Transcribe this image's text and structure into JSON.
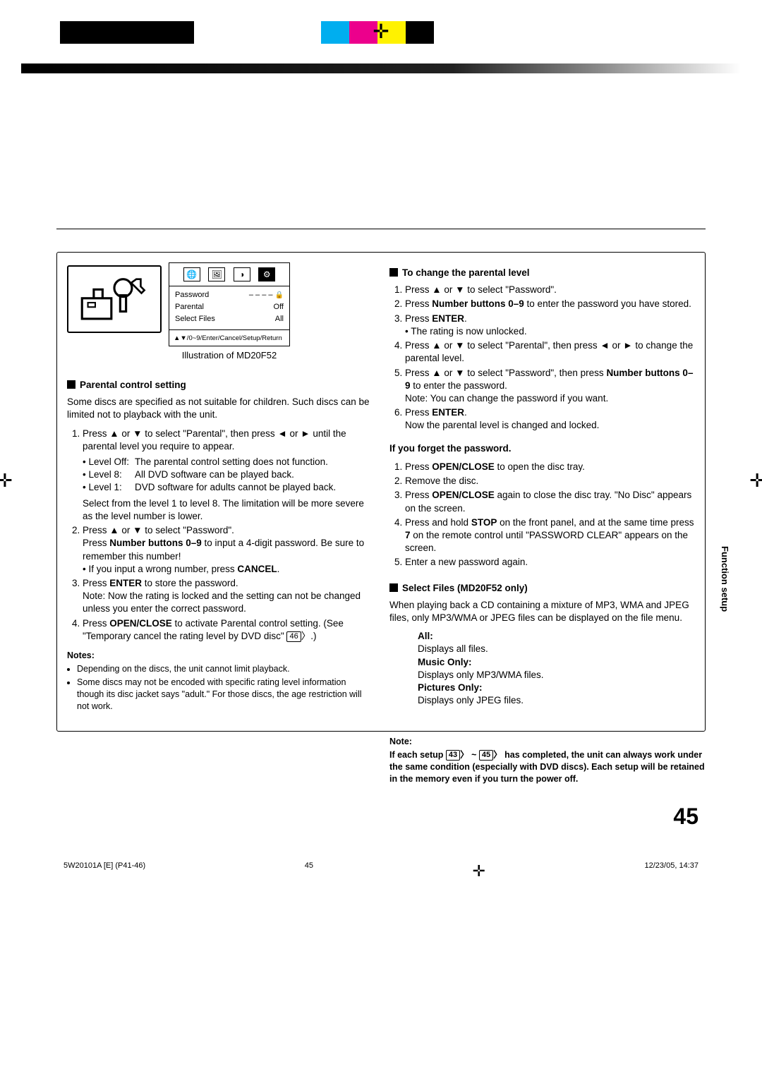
{
  "printMarks": {
    "crossGlyph": "✛"
  },
  "menu": {
    "row1": {
      "label": "Password",
      "value": "– – – –"
    },
    "row2": {
      "label": "Parental",
      "value": "Off"
    },
    "row3": {
      "label": "Select Files",
      "value": "All"
    },
    "hint": "▲▼/0~9/Enter/Cancel/Setup/Return",
    "caption": "Illustration of MD20F52"
  },
  "left": {
    "h1": "Parental control setting",
    "intro": "Some discs are specified as not suitable for children. Such discs can be limited not to playback with the unit.",
    "step1a": "Press ▲ or ▼ to select \"Parental\", then press ◄ or ► until the parental level you require to appear.",
    "lvlOff": {
      "lab": "• Level Off:",
      "txt": "The parental control setting does not function."
    },
    "lvl8": {
      "lab": "• Level 8:",
      "txt": "All DVD software can be played back."
    },
    "lvl1": {
      "lab": "• Level 1:",
      "txt": "DVD software for adults cannot be played back."
    },
    "step1b": "Select from the level 1 to level 8. The limitation will be more severe as the level number is lower.",
    "step2a": "Press ▲ or ▼ to select \"Password\".",
    "step2b_pre": "Press ",
    "step2b_bold": "Number buttons 0–9",
    "step2b_post": " to input a 4-digit password. Be sure to remember this number!",
    "step2c_pre": "• If you input a wrong number, press ",
    "step2c_bold": "CANCEL",
    "step2c_post": ".",
    "step3a_pre": "Press ",
    "step3a_bold": "ENTER",
    "step3a_post": " to store the password.",
    "step3b": "Note: Now the rating is locked and the setting can not be changed unless you enter the correct password.",
    "step4a_pre": "Press ",
    "step4a_bold": "OPEN/CLOSE",
    "step4a_post": " to activate Parental control setting. (See \"Temporary cancel the rating level by DVD disc\" ",
    "step4a_ref": "46",
    "step4a_end": ".)",
    "notesH": "Notes:",
    "note1": "Depending on the discs, the unit cannot limit playback.",
    "note2": "Some discs may not be encoded with specific rating level information though its disc jacket says \"adult.\" For those discs, the age restriction will not work."
  },
  "right": {
    "h1": "To change the parental level",
    "r1": "Press ▲ or ▼ to select \"Password\".",
    "r2_pre": "Press ",
    "r2_bold": "Number buttons 0–9",
    "r2_post": " to enter the password you have stored.",
    "r3_pre": "Press ",
    "r3_bold": "ENTER",
    "r3_post": ".",
    "r3b": "• The rating is now unlocked.",
    "r4": "Press ▲ or ▼ to select \"Parental\", then press ◄ or ► to change the parental level.",
    "r5a": "Press ▲ or ▼ to select \"Password\", then press",
    "r5_bold": "Number buttons 0–9",
    "r5_post": " to enter the password.",
    "r5b": "Note: You can change the password if you want.",
    "r6_pre": "Press ",
    "r6_bold": "ENTER",
    "r6_post": ".",
    "r6b": "Now the parental level is changed and locked.",
    "forgotH": "If you forget the password.",
    "f1_pre": "Press ",
    "f1_bold": "OPEN/CLOSE",
    "f1_post": " to open the disc tray.",
    "f2": "Remove the disc.",
    "f3_pre": "Press ",
    "f3_bold": "OPEN/CLOSE",
    "f3_post": " again to close the disc tray. \"No Disc\" appears on the screen.",
    "f4_pre": "Press and hold ",
    "f4_bold1": "STOP",
    "f4_mid": " on the front panel, and at the same time press ",
    "f4_bold2": "7",
    "f4_post": " on the remote control until \"PASSWORD CLEAR\" appears on the screen.",
    "f5": "Enter a new password again.",
    "h2": "Select Files (MD20F52 only)",
    "selIntro": "When playing back a CD containing a mixture of MP3, WMA and JPEG files, only MP3/WMA or JPEG files can be displayed on the file menu.",
    "allH": "All:",
    "allT": "Displays all files.",
    "musH": "Music Only:",
    "musT": "Displays only MP3/WMA files.",
    "picH": "Pictures Only:",
    "picT": "Displays only JPEG files.",
    "noteH": "Note:",
    "noteT_a": "If each setup ",
    "noteRef1": "43",
    "noteTilde": " ~ ",
    "noteRef2": "45",
    "noteT_b": " has completed, the unit can always work under the same condition (especially with DVD discs). Each setup will be retained in the memory even if you turn the power off."
  },
  "sideTab": "Function setup",
  "pageNum": "45",
  "footer": {
    "left": "5W20101A [E] (P41-46)",
    "center": "45",
    "right": "12/23/05, 14:37"
  }
}
